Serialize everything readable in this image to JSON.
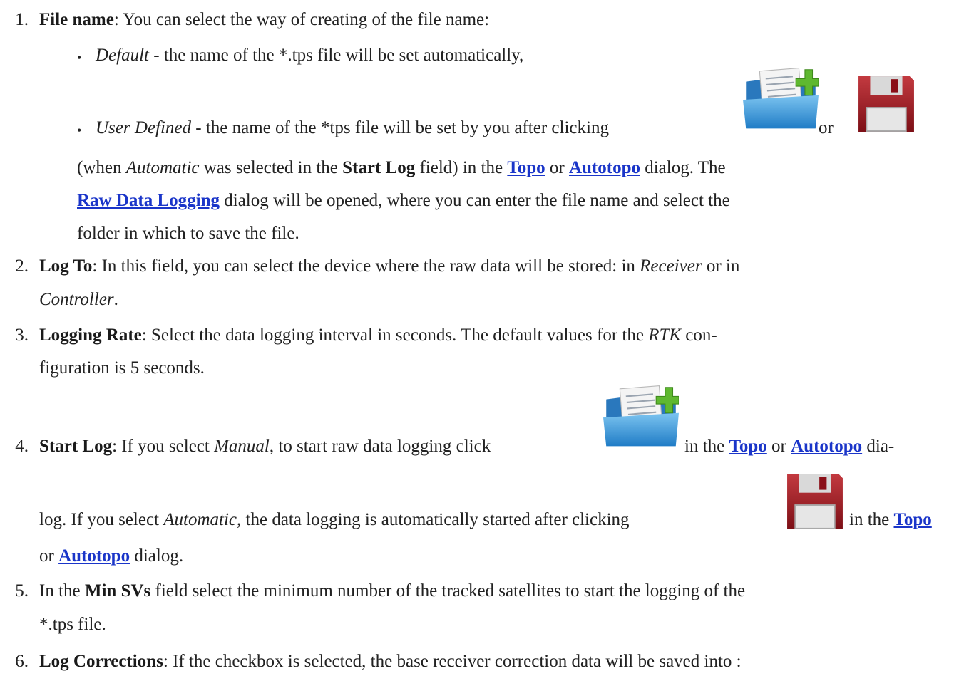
{
  "item1": {
    "number": "1.",
    "term": "File name",
    "text": ": You can select the way of creating of the file name:",
    "default": {
      "bullet": "•",
      "term": "Default",
      "text": " - the name of the *.tps file will be set automatically,"
    },
    "user_defined": {
      "bullet": "•",
      "term": "User Defined",
      "text_a": " - the name of the *tps file will be set by you after clicking",
      "or": "or",
      "line2_a": "(when ",
      "line2_b": "Automatic",
      "line2_c": " was selected in the ",
      "line2_d": "Start Log",
      "line2_e": " field) in the ",
      "link_topo": "Topo",
      "line2_f": " or ",
      "link_autotopo": "Autotopo",
      "line2_g": " dialog. The",
      "link_raw": "Raw Data Logging",
      "line3_a": " dialog will be opened, where you can enter the file name and select the",
      "line4": "folder in which to save the file."
    }
  },
  "item2": {
    "number": "2.",
    "term": "Log To",
    "text_a": ": In this field, you can select the device where the raw data will be stored: in ",
    "receiver": "Receiver",
    "text_b": " or in",
    "controller": "Controller",
    "text_c": "."
  },
  "item3": {
    "number": "3.",
    "term": "Logging Rate",
    "text_a": ": Select the data logging interval in seconds. The default values for the ",
    "rtk": "RTK",
    "text_b": " con-",
    "line2": "figuration is 5 seconds."
  },
  "item4": {
    "number": "4.",
    "term": "Start Log",
    "text_a": ": If you select ",
    "manual": "Manual",
    "text_b": ", to start raw data logging click",
    "text_c": "in the ",
    "link_topo": "Topo",
    "text_d": " or ",
    "link_autotopo": "Autotopo",
    "text_e": " dia-",
    "line2_a": "log. If you select ",
    "automatic": "Automatic",
    "line2_b": ", the data logging is automatically started after clicking",
    "line2_c": "in the ",
    "link_topo2": "Topo",
    "line3_a": "or ",
    "link_autotopo2": "Autotopo",
    "line3_b": " dialog."
  },
  "item5": {
    "number": "5.",
    "text_a": "In the ",
    "term": "Min SVs",
    "text_b": " field select the minimum number of the tracked satellites to start the logging of the",
    "line2": "*.tps file."
  },
  "item6": {
    "number": "6.",
    "term": "Log Corrections",
    "text": ": If the checkbox is selected, the base receiver correction data will be saved into :"
  },
  "icons": {
    "folder_new": "folder-add-icon",
    "floppy": "floppy-save-icon"
  },
  "colors": {
    "link": "#1a35c9",
    "text": "#222222",
    "folder_blue": "#2f8fd6",
    "plus_green": "#5fb830",
    "floppy_red": "#b3202a"
  }
}
